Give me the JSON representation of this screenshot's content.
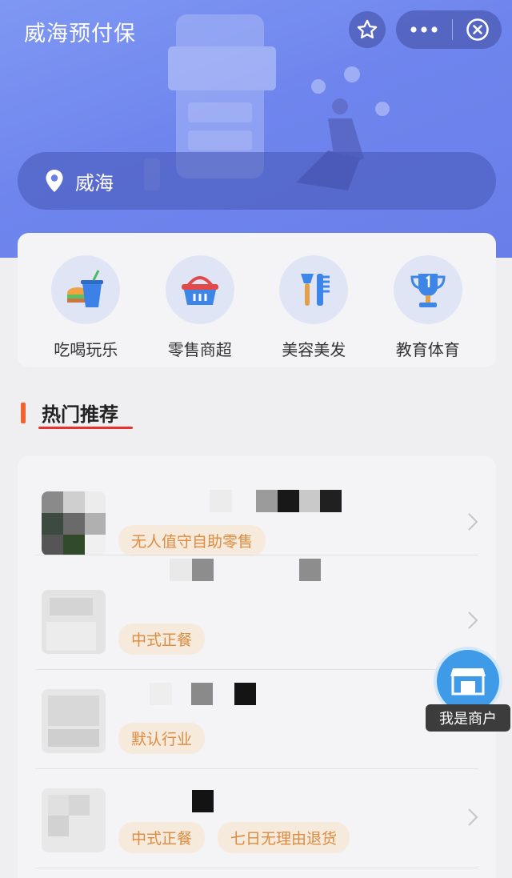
{
  "header": {
    "title": "威海预付保"
  },
  "location": {
    "city": "威海"
  },
  "categories": [
    {
      "label": "吃喝玩乐",
      "icon": "food-drink-icon"
    },
    {
      "label": "零售商超",
      "icon": "shopping-basket-icon"
    },
    {
      "label": "美容美发",
      "icon": "beauty-comb-icon"
    },
    {
      "label": "教育体育",
      "icon": "trophy-icon"
    }
  ],
  "recommend": {
    "title": "热门推荐",
    "items": [
      {
        "tags": [
          "无人值守自助零售"
        ]
      },
      {
        "tags": [
          "中式正餐"
        ]
      },
      {
        "tags": [
          "默认行业"
        ]
      },
      {
        "tags": [
          "中式正餐",
          "七日无理由退货"
        ]
      }
    ]
  },
  "merchant": {
    "label": "我是商户"
  },
  "colors": {
    "accent": "#6f85ee",
    "tag_text": "#dd8b3f",
    "section_bar": "#f0622e"
  }
}
